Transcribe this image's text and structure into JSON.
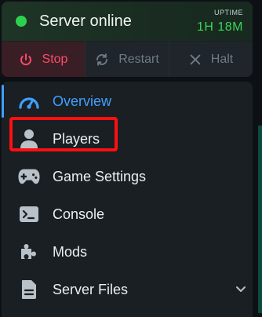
{
  "server": {
    "status_text": "Server online",
    "uptime_label": "UPTIME",
    "uptime_value": "1H 18M",
    "status_color": "#2ed14f"
  },
  "controls": {
    "stop_label": "Stop",
    "restart_label": "Restart",
    "halt_label": "Halt"
  },
  "nav": {
    "items": [
      {
        "label": "Overview",
        "icon": "gauge-icon",
        "active": true
      },
      {
        "label": "Players",
        "icon": "person-icon"
      },
      {
        "label": "Game Settings",
        "icon": "gamepad-icon"
      },
      {
        "label": "Console",
        "icon": "terminal-icon"
      },
      {
        "label": "Mods",
        "icon": "puzzle-icon"
      },
      {
        "label": "Server Files",
        "icon": "file-icon"
      }
    ]
  },
  "colors": {
    "accent": "#3ea0ff",
    "danger": "#ff4b6a",
    "online": "#39d45a",
    "highlight": "#ff1010"
  }
}
